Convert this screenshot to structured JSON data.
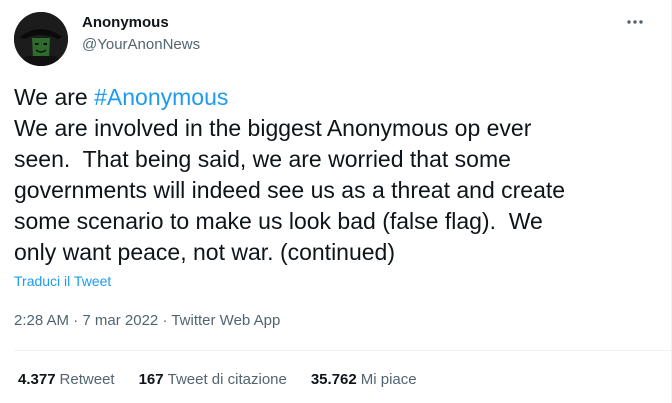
{
  "author": {
    "name": "Anonymous",
    "handle": "@YourAnonNews"
  },
  "tweet": {
    "line1_prefix": "We are ",
    "hashtag": "#Anonymous",
    "lines": [
      "We are involved in the biggest Anonymous op ever",
      "seen.  That being said, we are worried that some",
      "governments will indeed see us as a threat and create",
      "some scenario to make us look bad (false flag).  We",
      "only want peace, not war. (continued)"
    ],
    "translate_label": "Traduci il Tweet"
  },
  "meta": {
    "time": "2:28 AM",
    "separator": " · ",
    "date": "7 mar 2022",
    "source": "Twitter Web App"
  },
  "stats": {
    "retweets_count": "4.377",
    "retweets_label": "Retweet",
    "quotes_count": "167",
    "quotes_label": "Tweet di citazione",
    "likes_count": "35.762",
    "likes_label": "Mi piace"
  },
  "icons": {
    "more": "more-horizontal-icon",
    "avatar": "guy-fawkes-mask"
  },
  "colors": {
    "accent": "#1d9bf0",
    "text": "#0f1419",
    "secondary": "#536471",
    "border": "#eff3f4"
  }
}
